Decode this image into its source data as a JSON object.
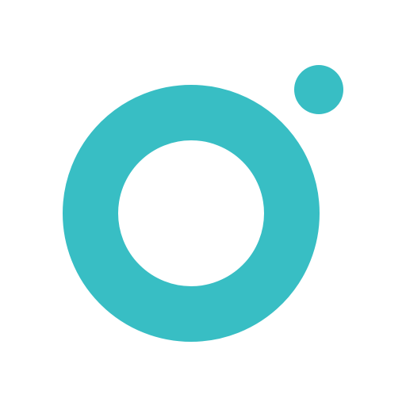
{
  "logo": {
    "name": "ring-with-dot-logo",
    "colors": {
      "background": "#ffffff",
      "brand": "#38bec4"
    }
  }
}
